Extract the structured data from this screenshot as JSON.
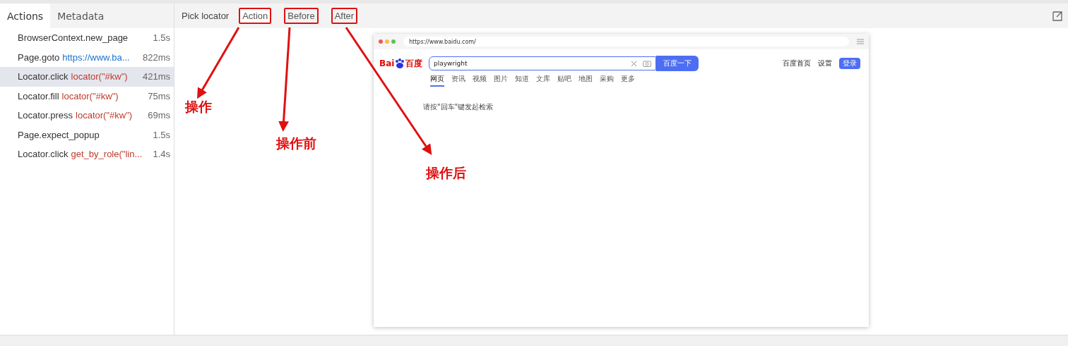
{
  "sidebar": {
    "tabs": [
      {
        "label": "Actions",
        "selected": true
      },
      {
        "label": "Metadata",
        "selected": false
      }
    ],
    "actions": [
      {
        "method": "BrowserContext.new_page",
        "duration": "1.5s",
        "selected": false
      },
      {
        "method": "Page.goto",
        "argument": "https://www.ba...",
        "kind": "url",
        "duration": "822ms",
        "selected": false
      },
      {
        "method": "Locator.click",
        "argument": "locator(\"#kw\")",
        "kind": "locator",
        "duration": "421ms",
        "selected": true
      },
      {
        "method": "Locator.fill",
        "argument": "locator(\"#kw\")",
        "kind": "locator",
        "duration": "75ms",
        "selected": false
      },
      {
        "method": "Locator.press",
        "argument": "locator(\"#kw\")",
        "kind": "locator",
        "duration": "69ms",
        "selected": false
      },
      {
        "method": "Page.expect_popup",
        "duration": "1.5s",
        "selected": false
      },
      {
        "method": "Locator.click",
        "argument": "get_by_role(\"lin...",
        "kind": "locator",
        "duration": "1.4s",
        "selected": false
      }
    ]
  },
  "snapshot": {
    "pick_locator": "Pick locator",
    "tabs": [
      {
        "label": "Action",
        "selected": true,
        "boxed": true
      },
      {
        "label": "Before",
        "selected": false,
        "boxed": true
      },
      {
        "label": "After",
        "selected": false,
        "boxed": true
      }
    ],
    "annotations": [
      {
        "label": "操作"
      },
      {
        "label": "操作前"
      },
      {
        "label": "操作后"
      }
    ],
    "browser": {
      "url": "https://www.baidu.com/",
      "logo": {
        "left": "Bai",
        "right": "百度"
      },
      "search_value": "playwright",
      "search_button": "百度一下",
      "top_links": [
        {
          "label": "百度首页",
          "kind": "link"
        },
        {
          "label": "设置",
          "kind": "link"
        },
        {
          "label": "登录",
          "kind": "button"
        }
      ],
      "nav": [
        {
          "label": "网页",
          "selected": true
        },
        {
          "label": "资讯",
          "selected": false
        },
        {
          "label": "视频",
          "selected": false
        },
        {
          "label": "图片",
          "selected": false
        },
        {
          "label": "知道",
          "selected": false
        },
        {
          "label": "文库",
          "selected": false
        },
        {
          "label": "贴吧",
          "selected": false
        },
        {
          "label": "地图",
          "selected": false
        },
        {
          "label": "采购",
          "selected": false
        },
        {
          "label": "更多",
          "selected": false
        }
      ],
      "hint": "请按\"回车\"键发起检索"
    }
  }
}
